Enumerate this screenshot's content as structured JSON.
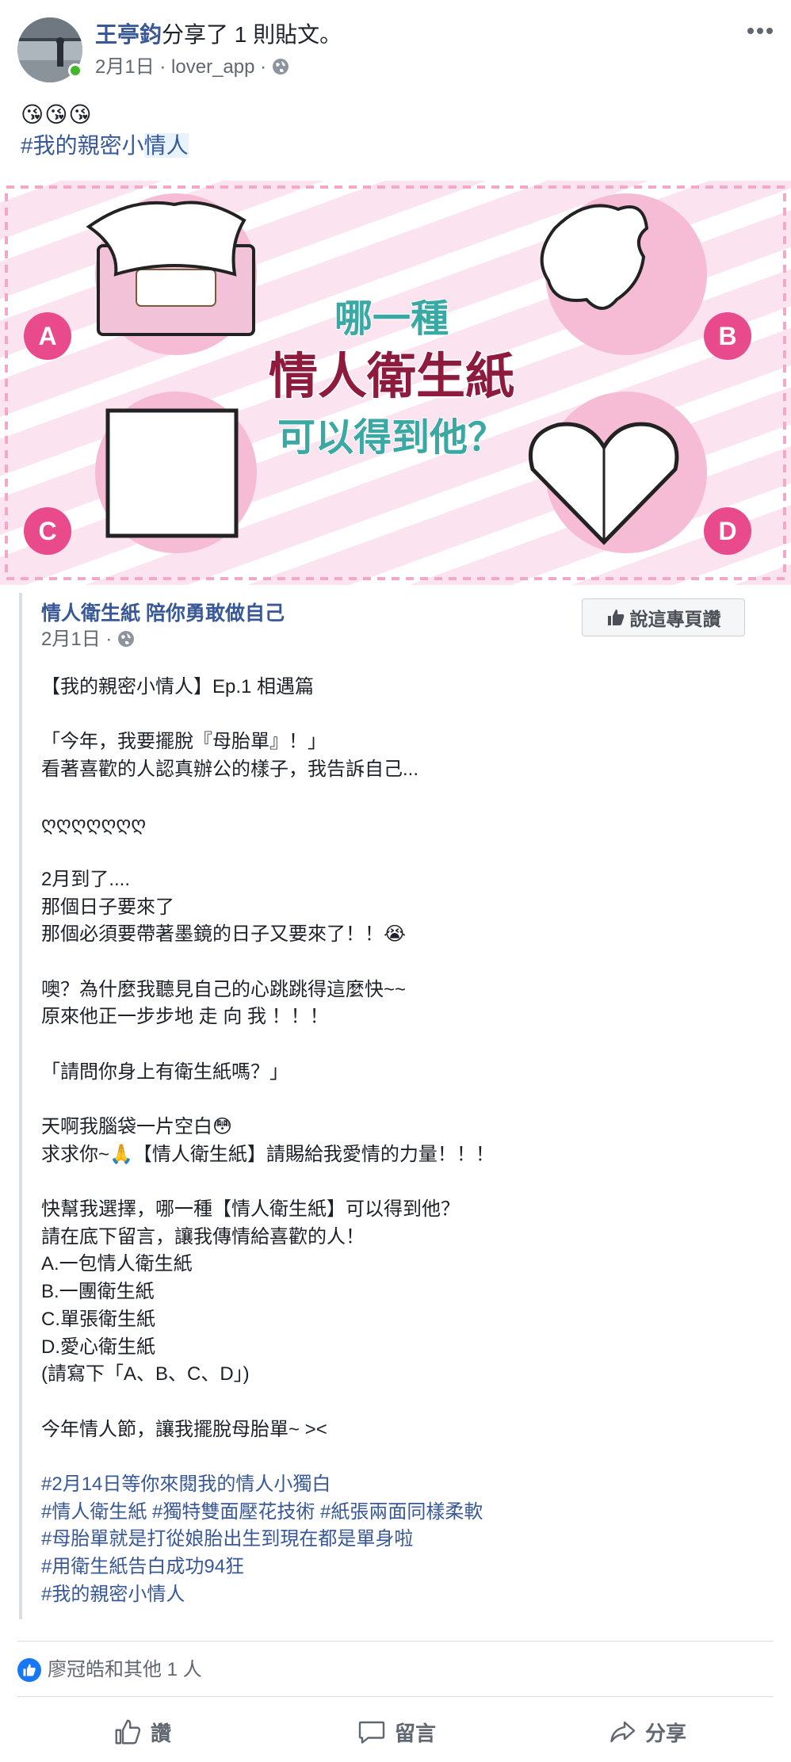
{
  "post": {
    "author_name": "王亭鈞",
    "action_text": "分享了 1 則貼文。",
    "date": "2月1日",
    "app": "lover_app",
    "emojis": "😘😘😘",
    "hashtag_prefix": "#我的親密小",
    "hashtag_highlight": "情人"
  },
  "banner": {
    "title_line1": "哪一種",
    "title_line2": "情人衛生紙",
    "title_line3": "可以得到他？",
    "labels": [
      "A",
      "B",
      "C",
      "D"
    ]
  },
  "shared": {
    "page_name": "情人衛生紙 陪你勇敢做自己",
    "date": "2月1日",
    "like_page_button": "說這專頁讚",
    "lines": [
      {
        "text": "【我的親密小情人】Ep.1 相遇篇",
        "tag": false
      },
      {
        "text": "",
        "tag": false
      },
      {
        "text": "「今年，我要擺脫『母胎單』！」",
        "tag": false
      },
      {
        "text": "看著喜歡的人認真辦公的樣子，我告訴自己...",
        "tag": false
      },
      {
        "text": "",
        "tag": false
      },
      {
        "text": "ღღღღღღღ",
        "tag": false
      },
      {
        "text": "",
        "tag": false
      },
      {
        "text": "2月到了....",
        "tag": false
      },
      {
        "text": "那個日子要來了",
        "tag": false
      },
      {
        "text": "那個必須要帶著墨鏡的日子又要來了！！😭",
        "tag": false
      },
      {
        "text": "",
        "tag": false
      },
      {
        "text": "噢？為什麼我聽見自己的心跳跳得這麼快~~",
        "tag": false
      },
      {
        "text": "原來他正一步步地 走 向 我 ！！！",
        "tag": false
      },
      {
        "text": "",
        "tag": false
      },
      {
        "text": "「請問你身上有衛生紙嗎？」",
        "tag": false
      },
      {
        "text": "",
        "tag": false
      },
      {
        "text": "天啊我腦袋一片空白😳",
        "tag": false
      },
      {
        "text": "求求你~🙏【情人衛生紙】請賜給我愛情的力量！！！",
        "tag": false
      },
      {
        "text": "",
        "tag": false
      },
      {
        "text": "快幫我選擇，哪一種【情人衛生紙】可以得到他？",
        "tag": false
      },
      {
        "text": "請在底下留言，讓我傳情給喜歡的人！",
        "tag": false
      },
      {
        "text": "A.一包情人衛生紙",
        "tag": false
      },
      {
        "text": "B.一團衛生紙",
        "tag": false
      },
      {
        "text": "C.單張衛生紙",
        "tag": false
      },
      {
        "text": "D.愛心衛生紙",
        "tag": false
      },
      {
        "text": "(請寫下「A、B、C、D」)",
        "tag": false
      },
      {
        "text": "",
        "tag": false
      },
      {
        "text": "今年情人節，讓我擺脫母胎單~ ><",
        "tag": false
      },
      {
        "text": "",
        "tag": false
      },
      {
        "text": "#2月14日等你來閱我的情人小獨白",
        "tag": true
      },
      {
        "text": "#情人衛生紙 #獨特雙面壓花技術 #紙張兩面同樣柔軟",
        "tag": true
      },
      {
        "text": "#母胎單就是打從娘胎出生到現在都是單身啦",
        "tag": true
      },
      {
        "text": "#用衛生紙告白成功94狂",
        "tag": true
      },
      {
        "text": "#我的親密小情人",
        "tag": true
      }
    ]
  },
  "reactions": {
    "text": "廖冠皓和其他 1 人"
  },
  "actions": {
    "like": "讚",
    "comment": "留言",
    "share": "分享"
  },
  "colors": {
    "link": "#385898",
    "pink": "#e94a8b",
    "teal": "#3aa9a4",
    "maroon": "#8e1b3e"
  }
}
